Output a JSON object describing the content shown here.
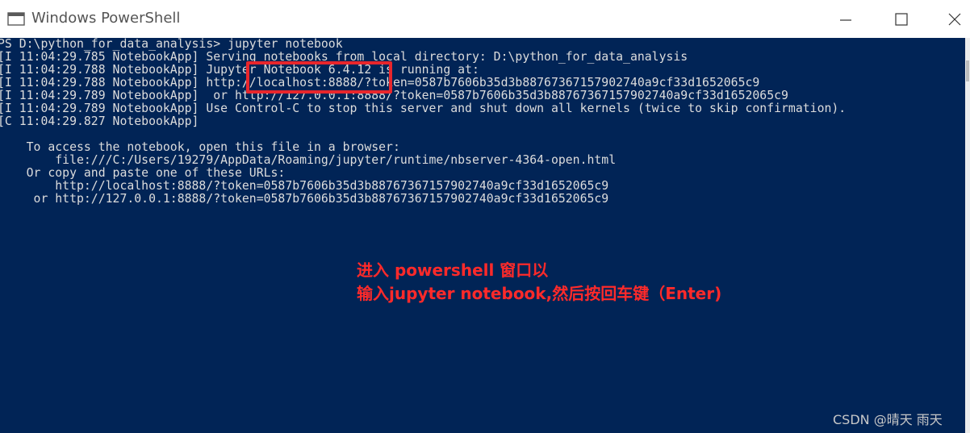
{
  "window": {
    "title": "Windows PowerShell",
    "controls": {
      "minimize": "minimize-icon",
      "maximize": "maximize-icon",
      "close": "close-icon"
    }
  },
  "console": {
    "lines": [
      "PS D:\\python_for_data_analysis> jupyter notebook",
      "[I 11:04:29.785 NotebookApp] Serving notebooks from local directory: D:\\python_for_data_analysis",
      "[I 11:04:29.788 NotebookApp] Jupyter Notebook 6.4.12 is running at:",
      "[I 11:04:29.788 NotebookApp] http://localhost:8888/?token=0587b7606b35d3b88767367157902740a9cf33d1652065c9",
      "[I 11:04:29.789 NotebookApp]  or http://127.0.0.1:8888/?token=0587b7606b35d3b88767367157902740a9cf33d1652065c9",
      "[I 11:04:29.789 NotebookApp] Use Control-C to stop this server and shut down all kernels (twice to skip confirmation).",
      "[C 11:04:29.827 NotebookApp]",
      "    To access the notebook, open this file in a browser:",
      "        file:///C:/Users/19279/AppData/Roaming/jupyter/runtime/nbserver-4364-open.html",
      "    Or copy and paste one of these URLs:",
      "        http://localhost:8888/?token=0587b7606b35d3b88767367157902740a9cf33d1652065c9",
      "     or http://127.0.0.1:8888/?token=0587b7606b35d3b88767367157902740a9cf33d1652065c9"
    ]
  },
  "annotation": {
    "line1": "进入 powershell 窗口以",
    "line2": "输入jupyter notebook,然后按回车键（Enter)",
    "color": "#ff2a2a",
    "highlight_color": "#e8262c"
  },
  "watermark": "CSDN @晴天 雨天",
  "colors": {
    "console_bg": "#012456",
    "console_text": "#dcdcdc"
  }
}
